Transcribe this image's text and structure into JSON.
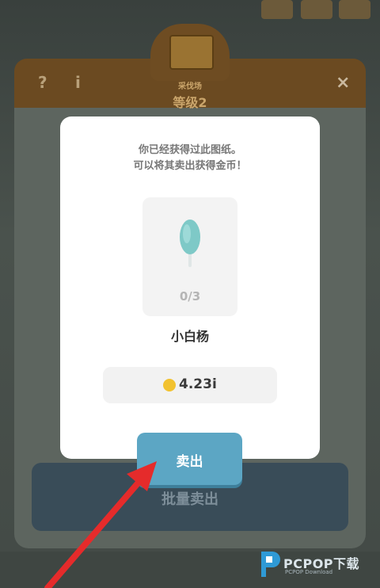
{
  "background": {
    "level_small": "采伐场",
    "level_title": "等级2",
    "help_label": "?",
    "info_label": "i",
    "close_label": "×",
    "bulk_sell_label": "批量卖出"
  },
  "dialog": {
    "message_line1": "你已经获得过此图纸。",
    "message_line2": "可以将其卖出获得金币！",
    "count": "0/3",
    "item_name": "小白杨",
    "price": "4.23i",
    "sell_label": "卖出"
  },
  "watermark": {
    "brand": "PCPOP下载",
    "sub": "PCPOP Download"
  },
  "colors": {
    "dialog_bg": "#ffffff",
    "sell_button": "#5ca6c4",
    "coin": "#f2c230",
    "arrow": "#e52b2b"
  }
}
